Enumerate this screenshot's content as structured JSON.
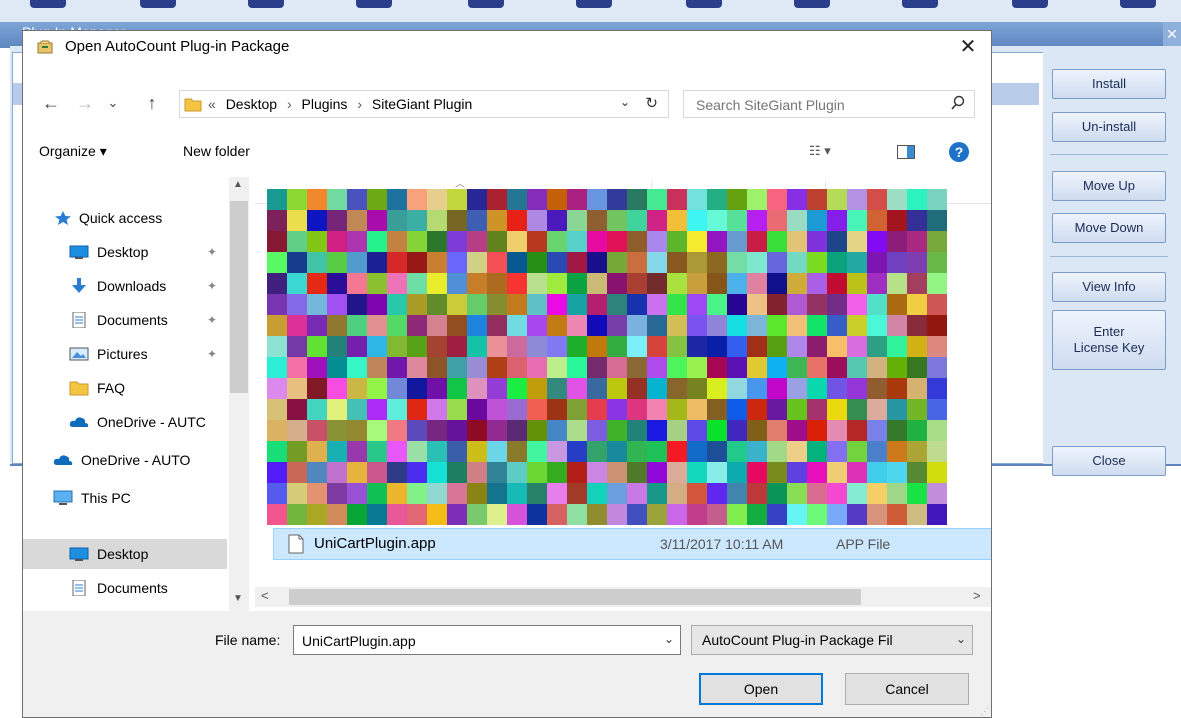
{
  "background_window": {
    "title": "Plug-In Manager",
    "buttons": {
      "install": "Install",
      "uninstall": "Un-install",
      "move_up": "Move Up",
      "move_down": "Move Down",
      "view_info": "View Info",
      "enter_license": "Enter\nLicense Key",
      "close": "Close"
    }
  },
  "dialog": {
    "title": "Open AutoCount Plug-in Package",
    "close_glyph": "✕",
    "nav": {
      "back": "←",
      "forward": "→",
      "recent": "⌄",
      "up": "↑"
    },
    "address": {
      "overflow": "«",
      "crumbs": [
        "Desktop",
        "Plugins",
        "SiteGiant Plugin"
      ],
      "separator": "›",
      "dropdown": "⌄",
      "refresh": "↻"
    },
    "search": {
      "placeholder": "Search SiteGiant Plugin"
    },
    "toolbar": {
      "organize": "Organize ▾",
      "new_folder": "New folder",
      "view": "☷ ▾",
      "help": "?"
    },
    "nav_pane": {
      "items": [
        {
          "label": "Quick access",
          "icon": "star-icon"
        },
        {
          "label": "Desktop",
          "icon": "desktop-icon",
          "pinned": true
        },
        {
          "label": "Downloads",
          "icon": "download-icon",
          "pinned": true
        },
        {
          "label": "Documents",
          "icon": "documents-icon",
          "pinned": true
        },
        {
          "label": "Pictures",
          "icon": "pictures-icon",
          "pinned": true
        },
        {
          "label": "FAQ",
          "icon": "folder-icon"
        },
        {
          "label": "OneDrive - AUTC",
          "icon": "onedrive-icon"
        },
        {
          "label": "OneDrive - AUTO",
          "icon": "onedrive-icon"
        },
        {
          "label": "This PC",
          "icon": "computer-icon"
        },
        {
          "label": "Desktop",
          "icon": "desktop-icon",
          "selected": true
        },
        {
          "label": "Documents",
          "icon": "documents-icon"
        }
      ],
      "pin_glyph": "✦"
    },
    "files": [
      {
        "name": "UniCartPlugin.app",
        "date": "3/11/2017 10:11 AM",
        "type": "APP File",
        "selected": true
      }
    ],
    "file_name_label": "File name:",
    "file_name_value": "UniCartPlugin.app",
    "file_type": "AutoCount Plug-in Package Fil",
    "open_label": "Open",
    "cancel_label": "Cancel"
  },
  "colors": {
    "selection": "#cce8ff",
    "accent": "#0078d7",
    "pm_blue": "#5d86c0"
  }
}
